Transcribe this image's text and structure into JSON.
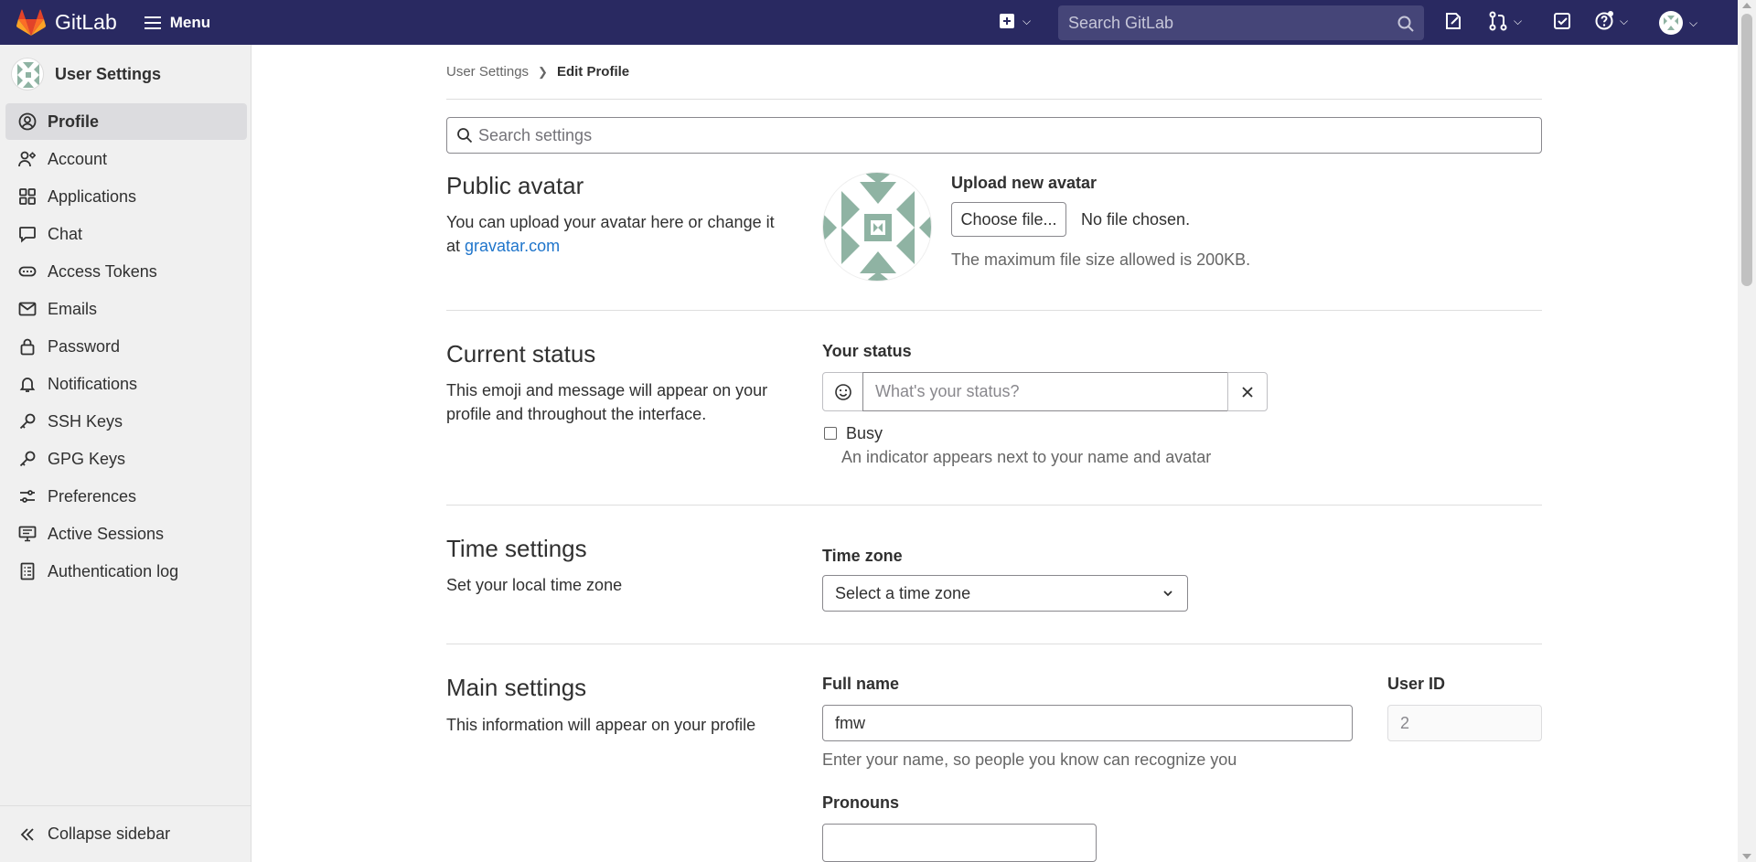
{
  "topbar": {
    "brand": "GitLab",
    "menu_label": "Menu",
    "search_placeholder": "Search GitLab"
  },
  "sidebar": {
    "title": "User Settings",
    "items": [
      {
        "label": "Profile",
        "icon": "profile-icon",
        "active": true
      },
      {
        "label": "Account",
        "icon": "account-icon"
      },
      {
        "label": "Applications",
        "icon": "applications-icon"
      },
      {
        "label": "Chat",
        "icon": "chat-icon"
      },
      {
        "label": "Access Tokens",
        "icon": "token-icon"
      },
      {
        "label": "Emails",
        "icon": "mail-icon"
      },
      {
        "label": "Password",
        "icon": "lock-icon"
      },
      {
        "label": "Notifications",
        "icon": "bell-icon"
      },
      {
        "label": "SSH Keys",
        "icon": "key-icon"
      },
      {
        "label": "GPG Keys",
        "icon": "key-icon"
      },
      {
        "label": "Preferences",
        "icon": "preferences-icon"
      },
      {
        "label": "Active Sessions",
        "icon": "monitor-icon"
      },
      {
        "label": "Authentication log",
        "icon": "log-icon"
      }
    ],
    "collapse_label": "Collapse sidebar"
  },
  "breadcrumb": {
    "parent": "User Settings",
    "current": "Edit Profile"
  },
  "settings_search": {
    "placeholder": "Search settings"
  },
  "avatar_section": {
    "title": "Public avatar",
    "desc": "You can upload your avatar here or change it at",
    "link": "gravatar.com",
    "upload_label": "Upload new avatar",
    "choose_button": "Choose file...",
    "no_file": "No file chosen.",
    "max_size": "The maximum file size allowed is 200KB."
  },
  "status_section": {
    "title": "Current status",
    "desc": "This emoji and message will appear on your profile and throughout the interface.",
    "label": "Your status",
    "placeholder": "What's your status?",
    "busy_label": "Busy",
    "busy_help": "An indicator appears next to your name and avatar"
  },
  "time_section": {
    "title": "Time settings",
    "desc": "Set your local time zone",
    "label": "Time zone",
    "select_value": "Select a time zone"
  },
  "main_section": {
    "title": "Main settings",
    "desc": "This information will appear on your profile",
    "fullname_label": "Full name",
    "fullname_value": "fmw",
    "fullname_help": "Enter your name, so people you know can recognize you",
    "userid_label": "User ID",
    "userid_value": "2",
    "pronouns_label": "Pronouns",
    "pronouns_value": ""
  },
  "colors": {
    "topbar": "#292961",
    "link": "#1f75cb",
    "avatar_pattern": "#8fb3a3"
  }
}
